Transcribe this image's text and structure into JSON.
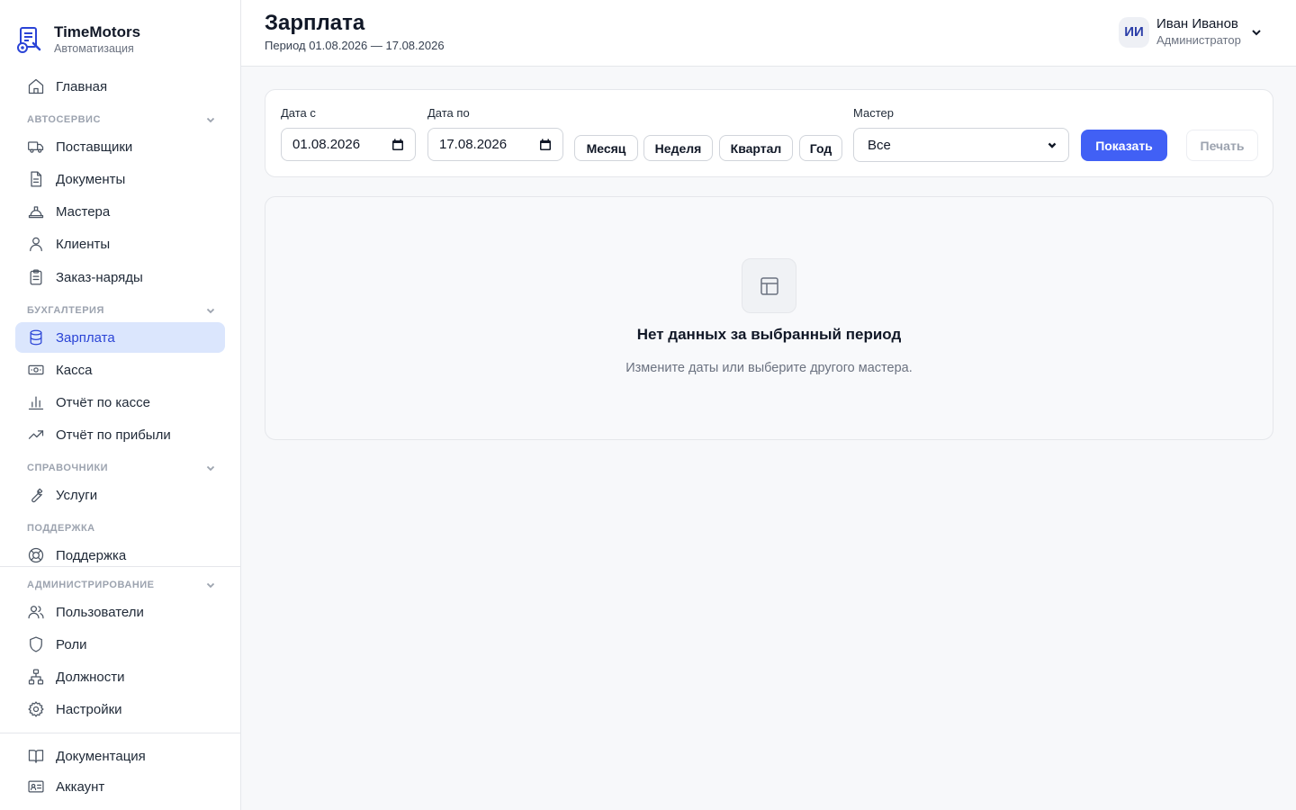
{
  "brand": {
    "title": "TimeMotors",
    "subtitle": "Автоматизация"
  },
  "sidebar": {
    "home": {
      "label": "Главная",
      "icon": "home-icon"
    },
    "sections": {
      "autoservice": "АВТОСЕРВИС",
      "accounting": "БУХГАЛТЕРИЯ",
      "references": "СПРАВОЧНИКИ",
      "support": "ПОДДЕРЖКА",
      "admin": "АДМИНИСТРИРОВАНИЕ"
    },
    "autoservice_items": [
      {
        "label": "Поставщики",
        "icon": "truck-icon"
      },
      {
        "label": "Документы",
        "icon": "document-icon"
      },
      {
        "label": "Мастера",
        "icon": "hard-hat-icon"
      },
      {
        "label": "Клиенты",
        "icon": "user-icon"
      },
      {
        "label": "Заказ-наряды",
        "icon": "clipboard-icon"
      }
    ],
    "accounting_items": [
      {
        "label": "Зарплата",
        "icon": "database-icon",
        "active": true
      },
      {
        "label": "Касса",
        "icon": "banknote-icon"
      },
      {
        "label": "Отчёт по кассе",
        "icon": "bar-chart-icon"
      },
      {
        "label": "Отчёт по прибыли",
        "icon": "trending-up-icon"
      }
    ],
    "reference_items": [
      {
        "label": "Услуги",
        "icon": "wrench-icon"
      }
    ],
    "support_items": [
      {
        "label": "Поддержка",
        "icon": "lifebuoy-icon"
      }
    ],
    "admin_items": [
      {
        "label": "Пользователи",
        "icon": "users-icon"
      },
      {
        "label": "Роли",
        "icon": "shield-icon"
      },
      {
        "label": "Должности",
        "icon": "org-chart-icon"
      },
      {
        "label": "Настройки",
        "icon": "gear-icon"
      }
    ],
    "footer_items": [
      {
        "label": "Документация",
        "icon": "book-icon"
      },
      {
        "label": "Аккаунт",
        "icon": "id-card-icon"
      }
    ]
  },
  "header": {
    "title": "Зарплата",
    "period": "Период 01.08.2026 — 17.08.2026",
    "user": {
      "initials": "ИИ",
      "name": "Иван Иванов",
      "role": "Администратор"
    }
  },
  "filters": {
    "date_from_label": "Дата с",
    "date_from_value": "01.08.2026",
    "date_to_label": "Дата по",
    "date_to_value": "17.08.2026",
    "quick": [
      "Месяц",
      "Неделя",
      "Квартал",
      "Год"
    ],
    "master_label": "Мастер",
    "master_value": "Все",
    "show_label": "Показать",
    "print_label": "Печать"
  },
  "empty_state": {
    "title": "Нет данных за выбранный период",
    "subtitle": "Измените даты или выберите другого мастера."
  },
  "colors": {
    "accent": "#4160f5",
    "active_bg": "#dbe6fd",
    "active_text": "#2b44d6"
  }
}
